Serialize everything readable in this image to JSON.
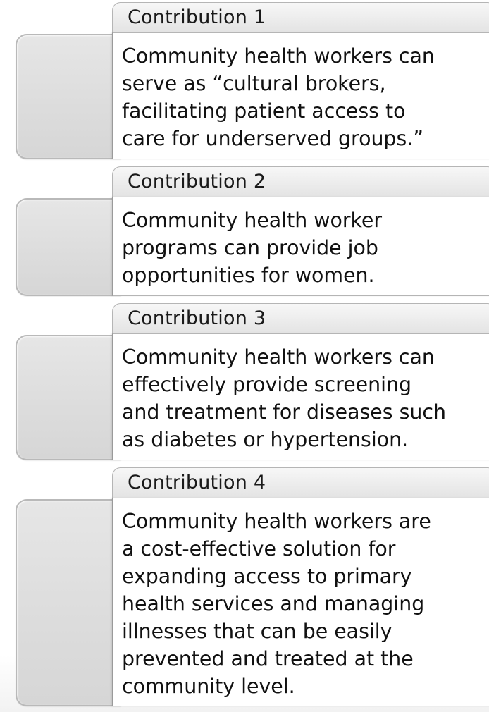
{
  "contributions": [
    {
      "label": "Contribution 1",
      "text": "Community health workers can\nserve as “cultural brokers,\nfacilitating patient access to\ncare for underserved groups.”"
    },
    {
      "label": "Contribution 2",
      "text": "Community health worker\nprograms can provide job\nopportunities for women."
    },
    {
      "label": "Contribution 3",
      "text": "Community health workers can\neffectively provide screening\nand treatment for diseases such\nas diabetes or hypertension."
    },
    {
      "label": "Contribution 4",
      "text": "Community health workers are\na cost-effective solution for\nexpanding access to primary\nhealth services and managing\nillnesses that can be easily\nprevented and treated at the\ncommunity level."
    }
  ]
}
